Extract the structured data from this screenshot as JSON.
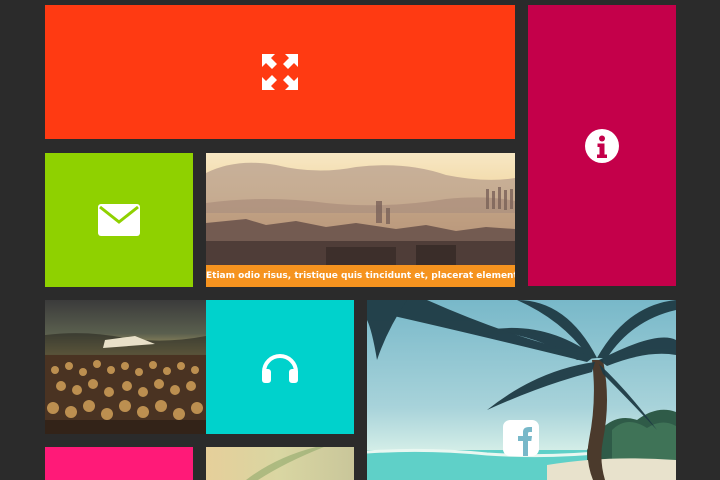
{
  "tiles": {
    "expand": {
      "color": "#ff3a12",
      "icon": "expand-arrows-icon"
    },
    "info": {
      "color": "#c4004a",
      "icon": "info-icon"
    },
    "mail": {
      "color": "#8fd100",
      "icon": "mail-icon"
    },
    "city": {
      "caption": "Etiam odio risus, tristique quis tincidunt et, placerat elementum.",
      "caption_color": "#f5931f"
    },
    "concert": {
      "image": "concert-crowd-photo"
    },
    "music": {
      "color": "#00d2cc",
      "icon": "headphones-icon"
    },
    "beach": {
      "icon": "facebook-icon",
      "image": "beach-palm-photo"
    },
    "pink": {
      "color": "#ff1a78"
    },
    "blur": {
      "image": "blurred-plant-photo"
    }
  }
}
